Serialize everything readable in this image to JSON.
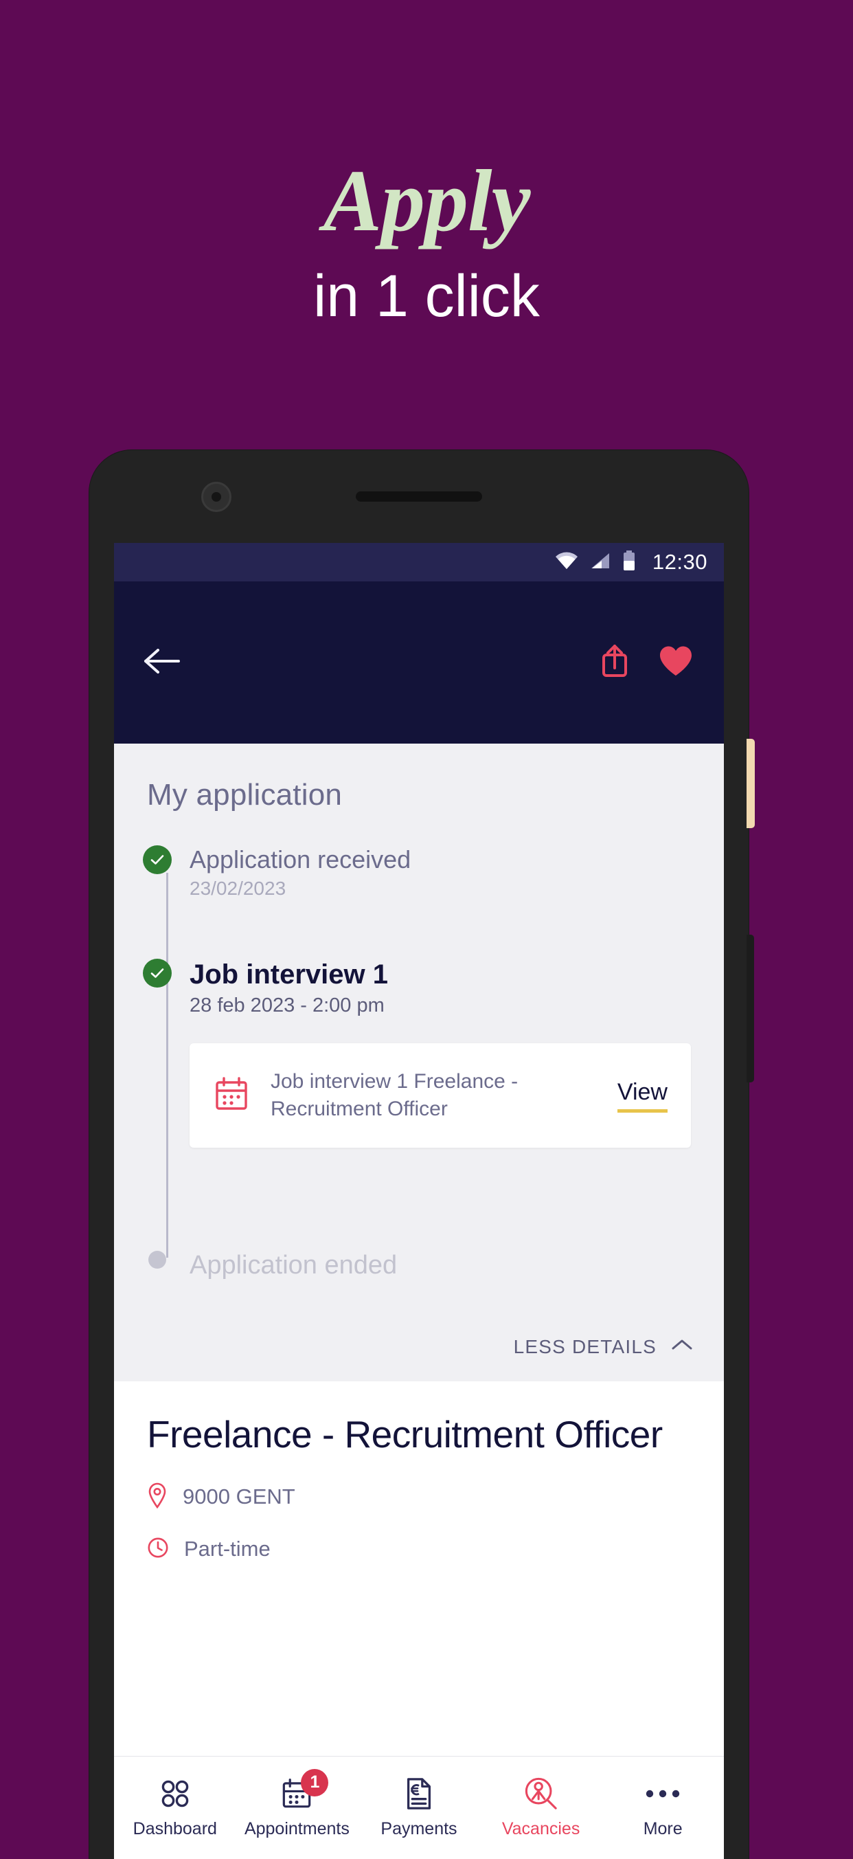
{
  "hero": {
    "line1": "Apply",
    "line2": "in 1 click",
    "line1_color": "#D2E6C4",
    "line2_color": "#FFFFFF",
    "background_color": "#5E0A54"
  },
  "statusbar": {
    "time": "12:30",
    "icons": [
      "wifi-icon",
      "cellular-signal-icon",
      "battery-icon"
    ],
    "background_color": "#262552"
  },
  "appbar": {
    "back_label": "back-arrow-icon",
    "share_label": "share-icon",
    "favorite_label": "heart-icon",
    "accent_color": "#E8465F",
    "background_color": "#131339"
  },
  "application_panel": {
    "title": "My application",
    "timeline": [
      {
        "status": "done",
        "title": "Application received",
        "subtitle": "23/02/2023"
      },
      {
        "status": "done",
        "title": "Job interview 1",
        "subtitle": "28 feb 2023 - 2:00 pm"
      },
      {
        "status": "pending",
        "title": "Application ended",
        "subtitle": ""
      }
    ],
    "card": {
      "icon": "calendar-icon",
      "text": "Job interview 1 Freelance - Recruitment Officer",
      "link_label": "View",
      "link_underline_color": "#E8C44B"
    },
    "toggle_label": "LESS DETAILS",
    "toggle_icon": "chevron-up-icon"
  },
  "job_detail": {
    "title": "Freelance - Recruitment Officer",
    "meta": [
      {
        "icon": "location-pin-icon",
        "label": "9000 GENT"
      },
      {
        "icon": "clock-icon",
        "label": "Part-time"
      }
    ]
  },
  "bottom_nav": {
    "items": [
      {
        "label": "Dashboard",
        "icon": "grid-dots-icon",
        "badge": "",
        "active": false
      },
      {
        "label": "Appointments",
        "icon": "calendar-icon",
        "badge": "1",
        "active": false
      },
      {
        "label": "Payments",
        "icon": "document-euro-icon",
        "badge": "",
        "active": false
      },
      {
        "label": "Vacancies",
        "icon": "person-search-icon",
        "badge": "",
        "active": true
      },
      {
        "label": "More",
        "icon": "ellipsis-icon",
        "badge": "",
        "active": false
      }
    ],
    "active_color": "#E8465F",
    "inactive_color": "#2B2B55"
  }
}
